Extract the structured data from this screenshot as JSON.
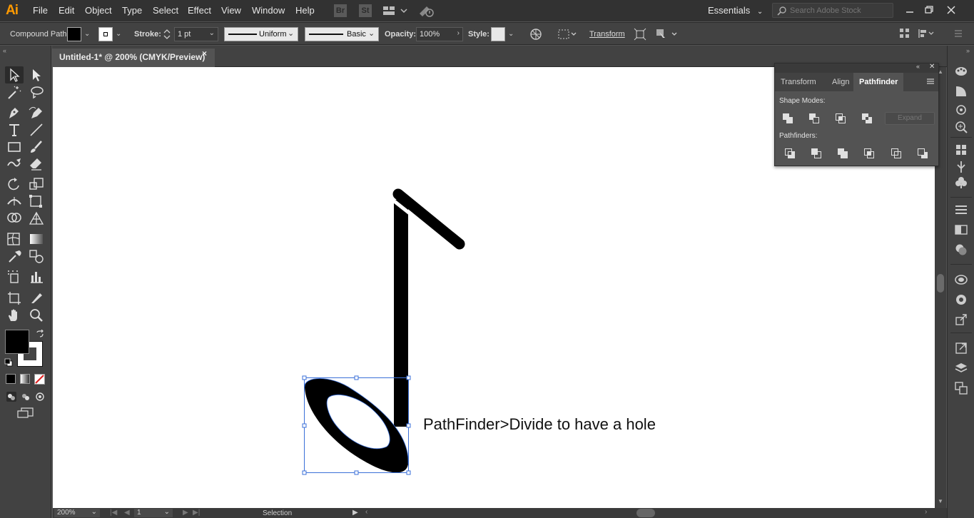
{
  "app": {
    "logo": "Ai"
  },
  "menu": [
    "File",
    "Edit",
    "Object",
    "Type",
    "Select",
    "Effect",
    "View",
    "Window",
    "Help"
  ],
  "bridge": {
    "br": "Br",
    "st": "St"
  },
  "workspace": {
    "label": "Essentials"
  },
  "search": {
    "placeholder": "Search Adobe Stock"
  },
  "control_bar": {
    "selection_type": "Compound Path",
    "stroke_label": "Stroke:",
    "stroke_weight": "1 pt",
    "profile": "Uniform",
    "brush": "Basic",
    "opacity_label": "Opacity:",
    "opacity": "100%",
    "style_label": "Style:",
    "transform_label": "Transform"
  },
  "document": {
    "tab_title": "Untitled-1* @ 200% (CMYK/Preview)",
    "close": "×",
    "annotation": "PathFinder>Divide to have a hole"
  },
  "status": {
    "zoom": "200%",
    "artboard": "1",
    "mode": "Selection"
  },
  "panel": {
    "tabs": [
      "Transform",
      "Align",
      "Pathfinder"
    ],
    "active_tab": "Pathfinder",
    "shape_modes_label": "Shape Modes:",
    "expand_label": "Expand",
    "pathfinders_label": "Pathfinders:"
  },
  "colors": {
    "accent": "#ff9a00",
    "selection": "#3a6fd8",
    "canvas": "#ffffff",
    "ui_dark": "#323232",
    "ui_mid": "#424242",
    "ui_panel": "#535353"
  }
}
